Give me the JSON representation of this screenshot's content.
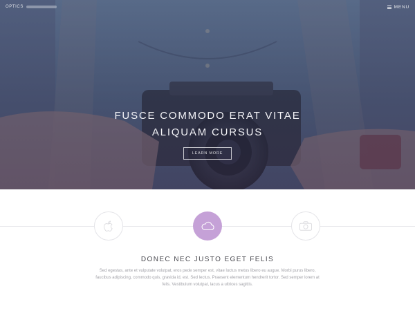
{
  "header": {
    "brand": "OPTICS",
    "menu_label": "MENU",
    "menu_icon": "hamburger-icon"
  },
  "hero": {
    "title_line1": "FUSCE COMMODO ERAT VITAE",
    "title_line2": "ALIQUAM CURSUS",
    "button_label": "LEARN MORE",
    "overlay_color": "#3f4a64"
  },
  "features": {
    "icons": [
      "apple-icon",
      "cloud-icon",
      "camera-icon"
    ],
    "active_color": "#c5a1d7",
    "title": "DONEC NEC JUSTO EGET FELIS",
    "body": "Sed egestas, ante et vulputate volutpat, eros pede semper est, vitae luctus metus libero eu augue. Morbi purus libero, faucibus adipiscing, commodo quis, gravida id, est. Sed lectus. Praesent elementum hendrerit tortor. Sed semper lorem at felis. Vestibulum volutpat, lacus a ultrices sagittis."
  }
}
